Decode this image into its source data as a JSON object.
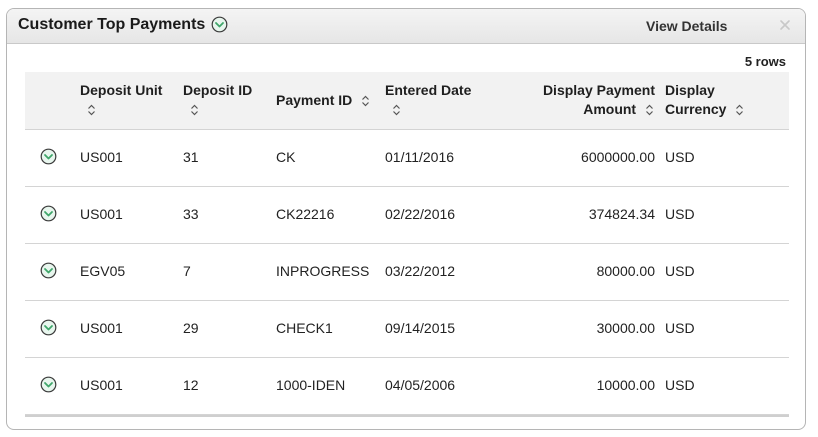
{
  "panel": {
    "title": "Customer Top Payments",
    "view_details_label": "View Details"
  },
  "grid": {
    "row_count_label": "5 rows",
    "columns": [
      {
        "line1": "Deposit Unit",
        "line2": ""
      },
      {
        "line1": "Deposit ID",
        "line2": ""
      },
      {
        "line1": "Payment ID",
        "line2": ""
      },
      {
        "line1": "Entered Date",
        "line2": ""
      },
      {
        "line1": "Display Payment",
        "line2": "Amount"
      },
      {
        "line1": "Display",
        "line2": "Currency"
      }
    ],
    "rows": [
      {
        "deposit_unit": "US001",
        "deposit_id": "31",
        "payment_id": "CK",
        "entered_date": "01/11/2016",
        "amount": "6000000.00",
        "currency": "USD"
      },
      {
        "deposit_unit": "US001",
        "deposit_id": "33",
        "payment_id": "CK22216",
        "entered_date": "02/22/2016",
        "amount": "374824.34",
        "currency": "USD"
      },
      {
        "deposit_unit": "EGV05",
        "deposit_id": "7",
        "payment_id": "INPROGRESS",
        "entered_date": "03/22/2012",
        "amount": "80000.00",
        "currency": "USD"
      },
      {
        "deposit_unit": "US001",
        "deposit_id": "29",
        "payment_id": "CHECK1",
        "entered_date": "09/14/2015",
        "amount": "30000.00",
        "currency": "USD"
      },
      {
        "deposit_unit": "US001",
        "deposit_id": "12",
        "payment_id": "1000-IDEN",
        "entered_date": "04/05/2006",
        "amount": "10000.00",
        "currency": "USD"
      }
    ]
  },
  "icons": {
    "row_action": "chevron-down-circle-icon",
    "sort": "sort-icon",
    "close": "close-icon"
  },
  "colors": {
    "accent_green": "#3fa66a",
    "header_bg": "#f2f2f2"
  }
}
